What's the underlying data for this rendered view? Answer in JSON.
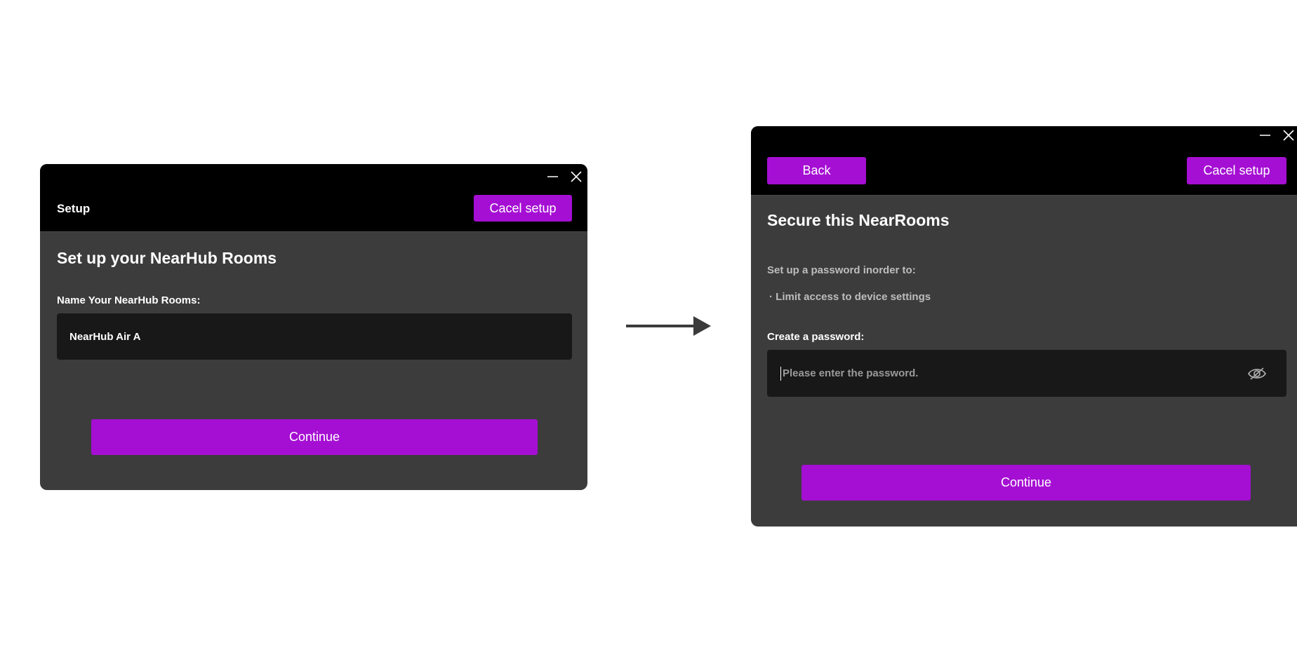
{
  "window1": {
    "header_title": "Setup",
    "cancel_label": "Cacel setup",
    "heading": "Set up your NearHub Rooms",
    "name_label": "Name Your NearHub Rooms:",
    "name_value": "NearHub Air A",
    "continue_label": "Continue"
  },
  "window2": {
    "back_label": "Back",
    "cancel_label": "Cacel setup",
    "heading": "Secure this NearRooms",
    "intro": "Set up a password inorder to:",
    "bullet": "· Limit access to device settings",
    "password_label": "Create a password:",
    "password_placeholder": "Please enter the password.",
    "continue_label": "Continue"
  },
  "icons": {
    "minimize": "minimize-icon",
    "close": "close-icon",
    "visibility": "eye-off-icon",
    "flow": "arrow-right-icon"
  },
  "colors": {
    "accent": "#a50fd3",
    "window_bg": "#3c3c3c",
    "header_bg": "#000000",
    "field_bg": "#181818"
  }
}
